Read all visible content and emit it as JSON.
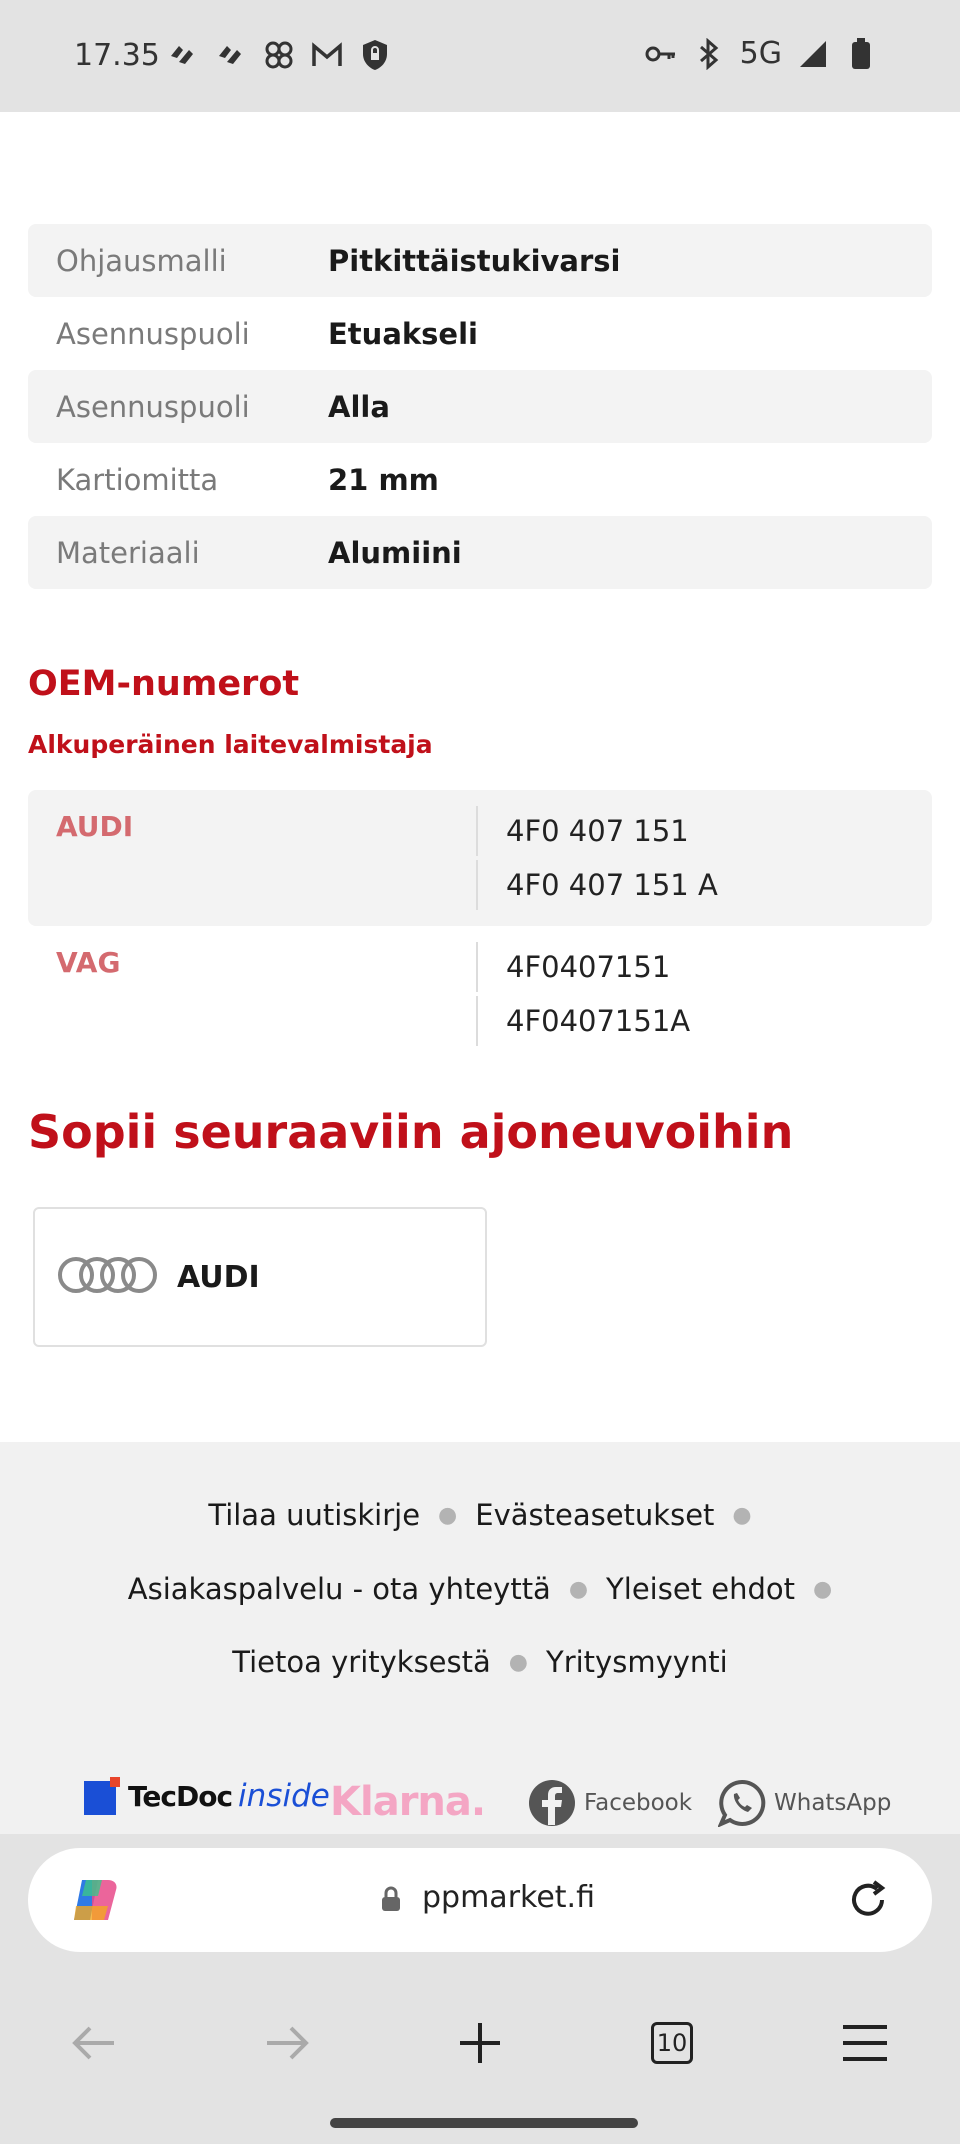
{
  "status_bar": {
    "time": "17.35",
    "network": "5G",
    "left_icons": [
      "bluesky-icon",
      "bluesky-icon",
      "pinwheel-icon",
      "gmail-icon",
      "shield-icon"
    ],
    "right_icons": [
      "vpn-key-icon",
      "bluetooth-icon",
      "signal-icon",
      "battery-icon"
    ]
  },
  "specs": [
    {
      "key": "Ohjausmalli",
      "value": "Pitkittäistukivarsi"
    },
    {
      "key": "Asennuspuoli",
      "value": "Etuakseli"
    },
    {
      "key": "Asennuspuoli",
      "value": "Alla"
    },
    {
      "key": "Kartiomitta",
      "value": "21 mm"
    },
    {
      "key": "Materiaali",
      "value": "Alumiini"
    }
  ],
  "oem": {
    "title": "OEM-numerot",
    "subtitle": "Alkuperäinen laitevalmistaja",
    "groups": [
      {
        "brand": "AUDI",
        "numbers": [
          "4F0 407 151",
          "4F0 407 151 A"
        ]
      },
      {
        "brand": "VAG",
        "numbers": [
          "4F0407151",
          "4F0407151A"
        ]
      }
    ]
  },
  "fits": {
    "title": "Sopii seuraaviin ajoneuvoihin",
    "brand": "AUDI"
  },
  "footer": {
    "links_line1": [
      "Tilaa uutiskirje",
      "Evästeasetukset"
    ],
    "links_line2": [
      "Asiakaspalvelu - ota yhteyttä",
      "Yleiset ehdot"
    ],
    "links_line3": [
      "Tietoa yrityksestä",
      "Yritysmyynti"
    ],
    "tecdoc_brand": "TecDoc",
    "tecdoc_suffix": "inside",
    "klarna": "Klarna.",
    "facebook": "Facebook",
    "whatsapp": "WhatsApp"
  },
  "browser": {
    "url": "ppmarket.fi",
    "tab_count": "10"
  },
  "colors": {
    "accent_red": "#c0101a",
    "brand_muted_red": "#d46a6f"
  }
}
